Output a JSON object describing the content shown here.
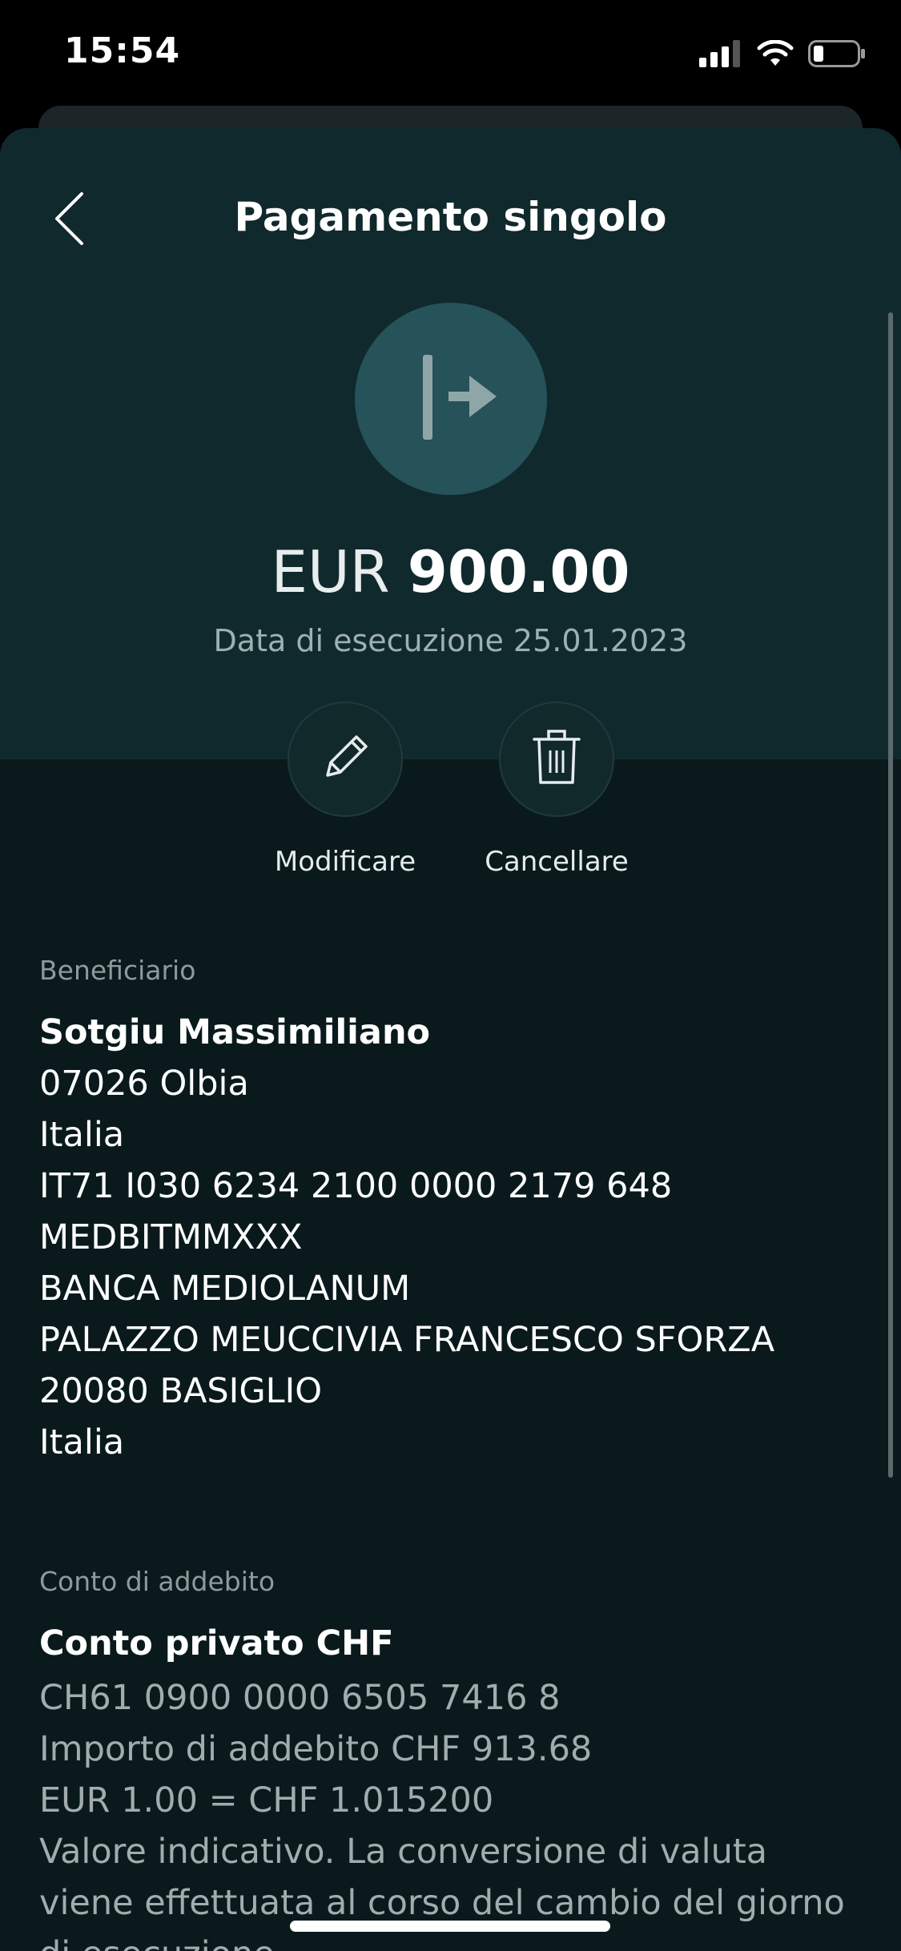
{
  "status_bar": {
    "time": "15:54"
  },
  "header": {
    "title": "Pagamento singolo",
    "back_icon": "chevron-left-icon"
  },
  "summary": {
    "icon": "outgoing-payment-icon",
    "currency": "EUR",
    "amount": "900.00",
    "execution_date": "Data di esecuzione 25.01.2023"
  },
  "actions": [
    {
      "label": "Modificare",
      "icon": "pencil-icon"
    },
    {
      "label": "Cancellare",
      "icon": "trash-icon"
    }
  ],
  "beneficiary": {
    "label": "Beneficiario",
    "name": "Sotgiu Massimiliano",
    "lines": [
      "07026 Olbia",
      "Italia",
      "IT71 I030 6234 2100 0000 2179 648",
      "MEDBITMMXXX",
      "BANCA MEDIOLANUM",
      "PALAZZO MEUCCIVIA FRANCESCO SFORZA",
      "20080 BASIGLIO",
      "Italia"
    ]
  },
  "debit_account": {
    "label": "Conto di addebito",
    "name": "Conto privato CHF",
    "iban": "CH61 0900 0000 6505 7416 8",
    "debit_amount": "Importo di addebito CHF 913.68",
    "rate": "EUR 1.00 = CHF 1.015200",
    "note": "Valore indicativo. La conversione di valuta viene effettuata al corso del cambio del giorno di esecuzione."
  },
  "colors": {
    "background": "#0a1a1c",
    "header_background": "#10292c",
    "icon_circle": "#265259",
    "muted_text": "#9fb0b2"
  }
}
